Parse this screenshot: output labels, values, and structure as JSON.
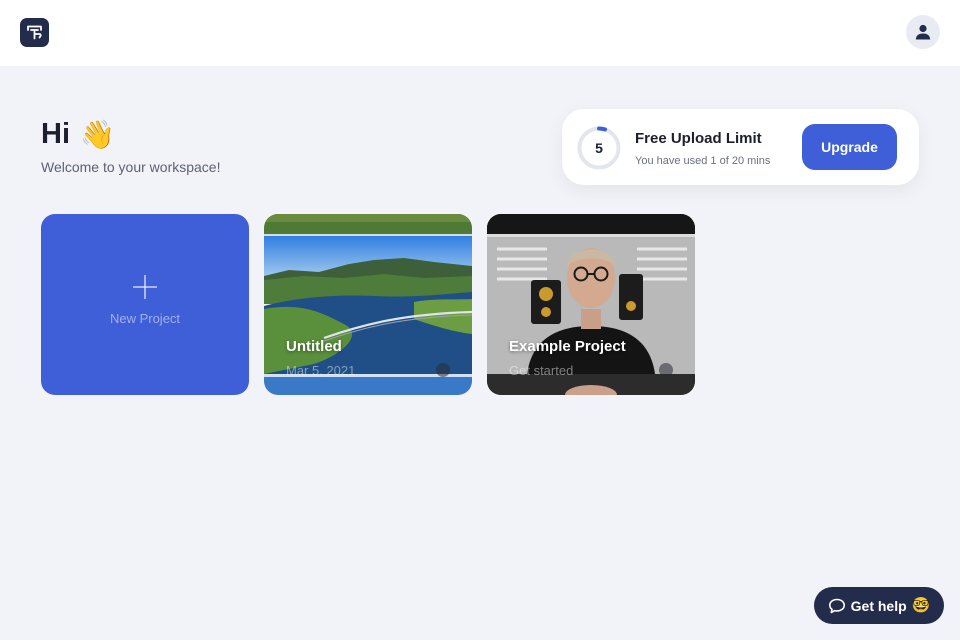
{
  "header": {
    "logo_icon": "app-logo-icon",
    "avatar_icon": "user-icon"
  },
  "greeting": {
    "title": "Hi",
    "emoji": "👋",
    "subtitle": "Welcome to your workspace!"
  },
  "upload_limit": {
    "percent_label": "5",
    "percent_used": 0.05,
    "title": "Free Upload Limit",
    "description": "You have used 1 of 20 mins",
    "upgrade_label": "Upgrade"
  },
  "projects": {
    "new_project_label": "New Project",
    "items": [
      {
        "title": "Untitled",
        "meta": "Mar 5, 2021",
        "thumbnail": "landscape-bridge-lake"
      },
      {
        "title": "Example Project",
        "meta": "Get started",
        "thumbnail": "person-presenting-video"
      }
    ]
  },
  "help": {
    "label": "Get help",
    "emoji": "🤓",
    "icon": "chat-bubble-icon"
  },
  "colors": {
    "accent": "#3f5fd8",
    "navy": "#242c4c",
    "background": "#f2f3f8"
  }
}
